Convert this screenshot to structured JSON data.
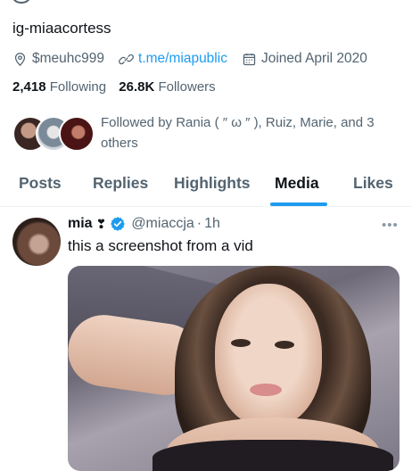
{
  "profile": {
    "handle": "ig-miaacortess",
    "location": "$meuhc999",
    "website": "t.me/miapublic",
    "joined": "Joined April 2020",
    "following_count": "2,418",
    "following_label": "Following",
    "followers_count": "26.8K",
    "followers_label": "Followers",
    "followed_by": "Followed by Rania ( ″ ω ″ ), Ruiz, Marie, and 3 others"
  },
  "tabs": [
    {
      "label": "Posts"
    },
    {
      "label": "Replies"
    },
    {
      "label": "Highlights"
    },
    {
      "label": "Media"
    },
    {
      "label": "Likes"
    }
  ],
  "active_tab": "Media",
  "post": {
    "name": "mia",
    "name_emoji": "❣",
    "handle": "@miaccja",
    "separator": "·",
    "time": "1h",
    "text": "this a screenshot from a vid",
    "more": "•••"
  },
  "icons": {
    "location": "location-pin-icon",
    "website": "link-icon",
    "joined": "calendar-icon",
    "verified": "verified-badge-icon"
  },
  "colors": {
    "accent": "#1d9bf0",
    "text": "#0f1419",
    "muted": "#536471"
  }
}
